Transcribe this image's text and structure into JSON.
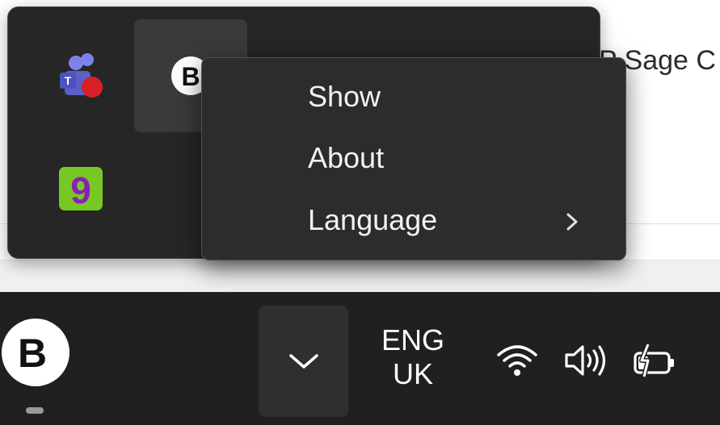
{
  "background_window": {
    "partial_text": "P Sage C"
  },
  "tray_flyout": {
    "icons": [
      {
        "name": "teams-icon",
        "badge_letter": "T"
      },
      {
        "name": "bitdefender-b-icon",
        "letter": "B"
      },
      {
        "name": "nine-app-icon",
        "digit": "9"
      }
    ]
  },
  "context_menu": {
    "items": [
      {
        "label": "Show"
      },
      {
        "label": "About"
      },
      {
        "label": "Language",
        "has_submenu": true
      }
    ]
  },
  "taskbar": {
    "app_icon_letter": "B",
    "language": {
      "line1": "ENG",
      "line2": "UK"
    },
    "system_icons": [
      "wifi-icon",
      "volume-icon",
      "battery-charging-icon"
    ]
  },
  "colors": {
    "flyout_bg": "#262626",
    "menu_bg": "#2c2c2c",
    "taskbar_bg": "#202020",
    "menu_text": "#f2f2f2"
  }
}
